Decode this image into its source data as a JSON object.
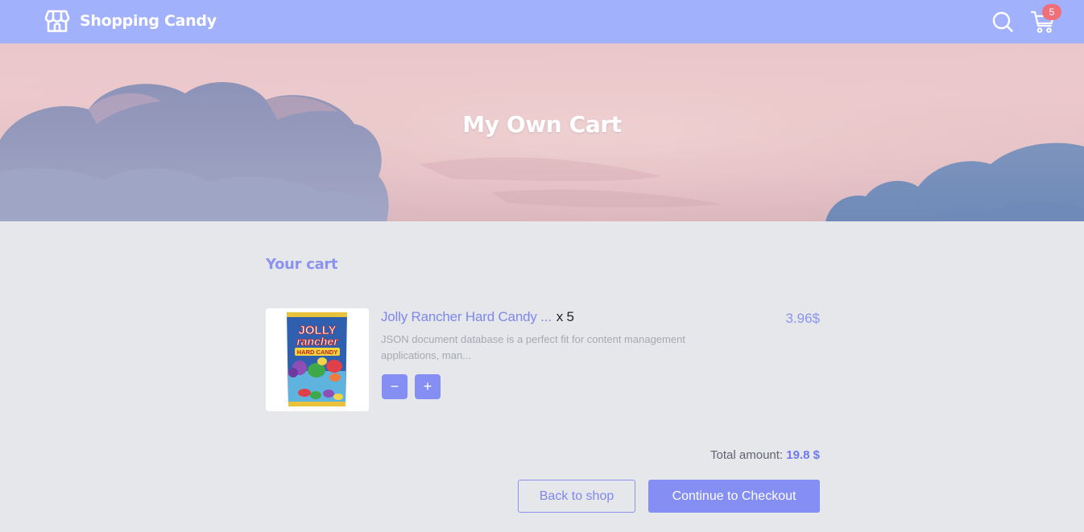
{
  "header": {
    "brand_name": "Shopping Candy",
    "brand_icon": "storefront-icon",
    "search_icon": "search-icon",
    "cart_icon": "cart-icon",
    "cart_count": "5",
    "background_color": "#a2b1fc"
  },
  "hero": {
    "title": "My Own Cart"
  },
  "cart": {
    "section_title": "Your cart",
    "items": [
      {
        "name": "Jolly Rancher Hard Candy ...",
        "quantity_label": "x 5",
        "price": "3.96$",
        "description": "JSON document database is a perfect fit for content management applications, man...",
        "decrease_label": "−",
        "increase_label": "+",
        "image_lettering": [
          "JOLLY",
          "rancher",
          "HARD CANDY"
        ]
      }
    ],
    "total_label": "Total amount:",
    "total_value": "19.8 $",
    "back_button": "Back to shop",
    "checkout_button": "Continue to Checkout"
  },
  "colors": {
    "accent": "#858ef3",
    "accent_text": "#7f87ec",
    "badge": "#f0707a",
    "page_background": "#e6e7eb"
  }
}
